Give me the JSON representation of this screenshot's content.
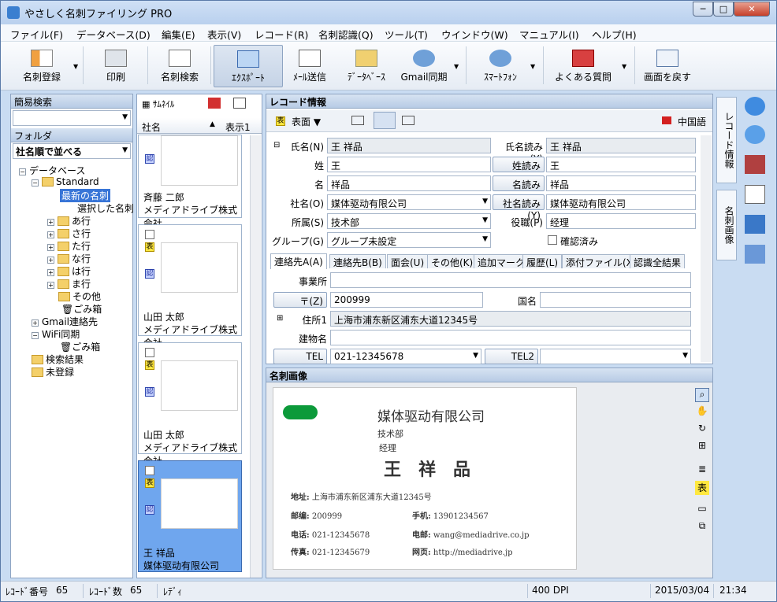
{
  "app": {
    "title": "やさしく名刺ファイリング PRO",
    "min": "─",
    "max": "□",
    "close": "✕"
  },
  "menu": [
    "ファイル(F)",
    "データベース(D)",
    "編集(E)",
    "表示(V)",
    "レコード(R)",
    "名刺認識(Q)",
    "ツール(T)",
    "ウインドウ(W)",
    "マニュアル(I)",
    "ヘルプ(H)"
  ],
  "toolbar": {
    "register": "名刺登録",
    "print": "印刷",
    "search": "名刺検索",
    "export": "ｴｸｽﾎﾟｰﾄ",
    "mail": "ﾒｰﾙ送信",
    "database": "ﾃﾞｰﾀﾍﾞｰｽ",
    "gmail": "Gmail同期",
    "smartphone": "ｽﾏｰﾄﾌｫﾝ",
    "faq": "よくある質問",
    "restore": "画面を戻す"
  },
  "left": {
    "quick_search": "簡易検索",
    "folder": "フォルダ",
    "sort": "社名順で並べる",
    "tree": [
      "データベース",
      "Standard",
      "最新の名刺",
      "選択した名刺",
      "あ行",
      "さ行",
      "た行",
      "な行",
      "は行",
      "ま行",
      "その他",
      "ごみ箱",
      "Gmail連絡先",
      "WiFi同期",
      "ごみ箱",
      "検索結果",
      "未登録"
    ]
  },
  "list": {
    "view": "ｻﾑﾈｲﾙ",
    "col_company": "社名",
    "sort_arrow": "▲",
    "col_display": "表示1",
    "cards": [
      {
        "name": "斉藤 二郎",
        "company": "メディアドライブ株式会社"
      },
      {
        "name": "山田 太郎",
        "company": "メディアドライブ株式会社"
      },
      {
        "name": "山田 太郎",
        "company": "メディアドライブ株式会社"
      },
      {
        "name": "王 祥品",
        "company": "媒体驱动有限公司"
      }
    ]
  },
  "record": {
    "header": "レコード情報",
    "view": "表面",
    "lang": "中国語",
    "labels": {
      "fullname": "氏名(N)",
      "last": "姓",
      "first": "名",
      "company": "社名(O)",
      "dept": "所属(S)",
      "group": "グループ(G)",
      "reading": "氏名読み(Y)",
      "last_r": "姓読み",
      "first_r": "名読み",
      "company_r": "社名読み(Y)",
      "title": "役職(P)",
      "confirmed": "確認済み"
    },
    "values": {
      "fullname": "王 祥品",
      "last": "王",
      "first": "祥品",
      "company": "媒体驱动有限公司",
      "dept": "技术部",
      "group": "グループ未設定",
      "reading": "王 祥品",
      "last_r": "王",
      "first_r": "祥品",
      "company_r": "媒体驱动有限公司",
      "title": "经理"
    },
    "tabs": [
      "連絡先A(A)",
      "連絡先B(B)",
      "面会(U)",
      "その他(K)",
      "追加マーク",
      "履歴(L)",
      "添付ファイル(X)",
      "認識全結果"
    ],
    "contact": {
      "office": "事業所",
      "zip_btn": "〒(Z)",
      "zip": "200999",
      "country": "国名",
      "addr1": "住所1",
      "addr1_val": "上海市浦东新区浦东大道12345号",
      "building": "建物名",
      "tel_btn": "TEL",
      "tel": "021-12345678",
      "tel2_btn": "TEL2"
    }
  },
  "image": {
    "header": "名刺画像",
    "card": {
      "company": "媒体驱动有限公司",
      "dept": "技术部",
      "title": "经理",
      "name": "王　祥　品",
      "addr_label": "地址:",
      "addr": "上海市浦东新区浦东大道12345号",
      "zip_label": "邮编:",
      "zip": "200999",
      "mobile_label": "手机:",
      "mobile": "13901234567",
      "tel_label": "电话:",
      "tel": "021-12345678",
      "email_label": "电邮:",
      "email": "wang@mediadrive.co.jp",
      "fax_label": "传真:",
      "fax": "021-12345679",
      "web_label": "网页:",
      "web": "http://mediadrive.jp"
    }
  },
  "sidetabs": {
    "record": "レコード情報",
    "image": "名刺画像"
  },
  "status": {
    "rec_no_label": "ﾚｺｰﾄﾞ番号",
    "rec_no": "65",
    "rec_cnt_label": "ﾚｺｰﾄﾞ数",
    "rec_cnt": "65",
    "ready": "ﾚﾃﾞｨ",
    "dpi": "400 DPI",
    "date": "2015/03/04",
    "time": "21:34"
  }
}
